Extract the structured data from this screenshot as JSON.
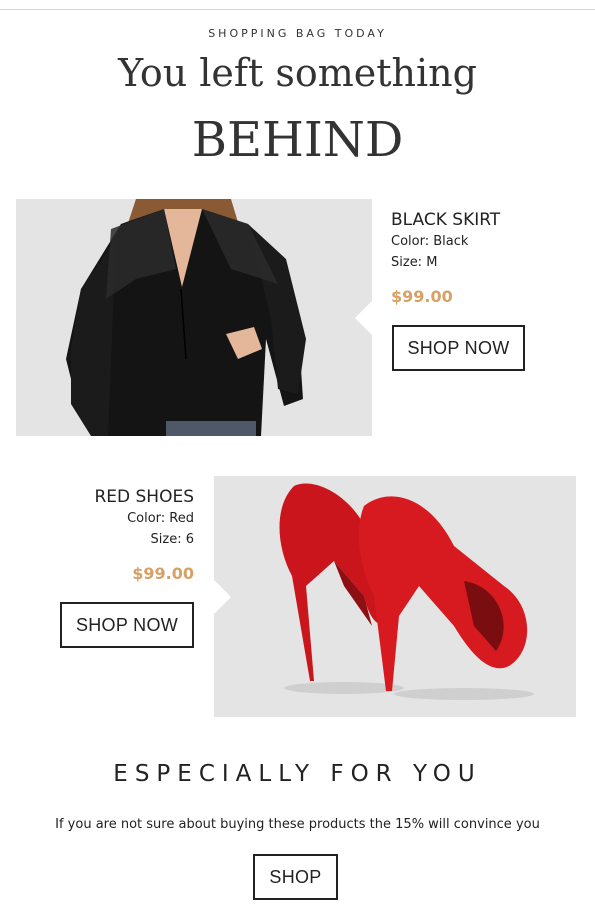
{
  "header": {
    "kicker": "SHOPPING BAG TODAY",
    "headline": "You left something",
    "headline_big": "BEHIND"
  },
  "products": [
    {
      "name": "BLACK SKIRT",
      "color": "Color: Black",
      "size": "Size: M",
      "price": "$99.00",
      "button": "SHOP NOW",
      "image": "black-lace-blouse-photo"
    },
    {
      "name": "RED SHOES",
      "color": "Color: Red",
      "size": "Size: 6",
      "price": "$99.00",
      "button": "SHOP NOW",
      "image": "red-suede-high-heels-photo"
    }
  ],
  "promo": {
    "title": "ESPECIALLY FOR YOU",
    "text": "If you are not sure about buying these products the 15% will convince you",
    "button": "SHOP"
  },
  "colors": {
    "price": "#d7a064",
    "image_bg": "#e4e4e4",
    "text": "#222222"
  }
}
